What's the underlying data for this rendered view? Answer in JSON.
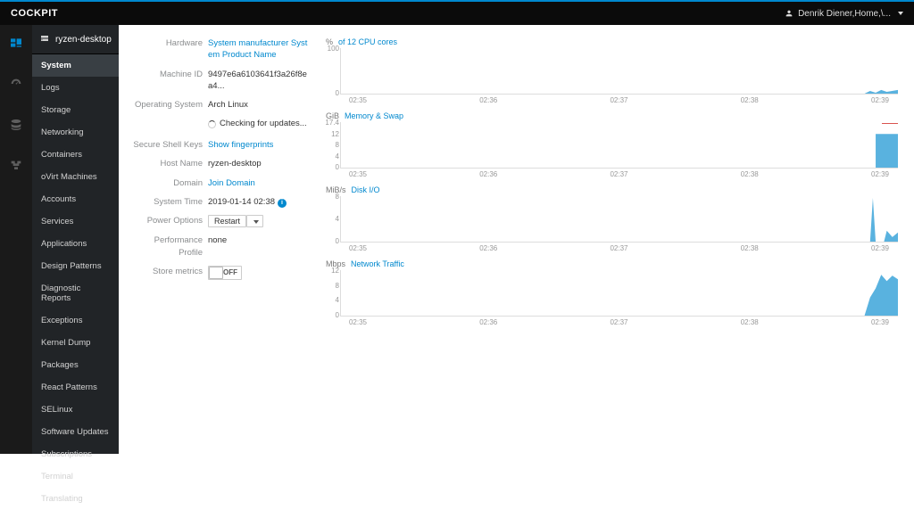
{
  "brand": "COCKPIT",
  "user_name": "Denrik Diener,Home,\\...",
  "host_name_header": "ryzen-desktop",
  "sidebar": {
    "items": [
      {
        "label": "System",
        "active": true
      },
      {
        "label": "Logs"
      },
      {
        "label": "Storage"
      },
      {
        "label": "Networking"
      },
      {
        "label": "Containers"
      },
      {
        "label": "oVirt Machines"
      },
      {
        "label": "Accounts"
      },
      {
        "label": "Services"
      },
      {
        "label": "Applications"
      },
      {
        "label": "Design Patterns"
      },
      {
        "label": "Diagnostic Reports"
      },
      {
        "label": "Exceptions"
      },
      {
        "label": "Kernel Dump"
      },
      {
        "label": "Packages"
      },
      {
        "label": "React Patterns"
      },
      {
        "label": "SELinux"
      },
      {
        "label": "Software Updates"
      },
      {
        "label": "Subscriptions"
      },
      {
        "label": "Terminal"
      },
      {
        "label": "Translating"
      }
    ]
  },
  "details": {
    "hardware_label": "Hardware",
    "hardware_value": "System manufacturer System Product Name",
    "machineid_label": "Machine ID",
    "machineid_value": "9497e6a6103641f3a26f8ea4...",
    "os_label": "Operating System",
    "os_value": "Arch Linux",
    "updates_value": "Checking for updates...",
    "ssh_label": "Secure Shell Keys",
    "ssh_value": "Show fingerprints",
    "hostname_label": "Host Name",
    "hostname_value": "ryzen-desktop",
    "domain_label": "Domain",
    "domain_value": "Join Domain",
    "systime_label": "System Time",
    "systime_value": "2019-01-14 02:38",
    "power_label": "Power Options",
    "power_value": "Restart",
    "perf_label": "Performance Profile",
    "perf_value": "none",
    "metrics_label": "Store metrics",
    "metrics_toggle": "OFF"
  },
  "x_ticks": [
    "02:35",
    "02:36",
    "02:37",
    "02:38",
    "02:39"
  ],
  "chart_data": [
    {
      "type": "area",
      "unit": "%",
      "title": "of 12 CPU cores",
      "ylim": [
        0,
        100
      ],
      "y_ticks": [
        "100",
        "0"
      ],
      "x": [
        "02:35",
        "02:36",
        "02:37",
        "02:38",
        "02:39"
      ],
      "series": [
        {
          "name": "cpu",
          "values_approx": "near 0 until ~02:38:45, small spike to ~8% near end"
        }
      ]
    },
    {
      "type": "area",
      "unit": "GiB",
      "title": "Memory & Swap",
      "ylim": [
        0,
        17.4
      ],
      "y_ticks": [
        "17.4",
        "12",
        "8",
        "4",
        "0"
      ],
      "x": [
        "02:35",
        "02:36",
        "02:37",
        "02:38",
        "02:39"
      ],
      "series": [
        {
          "name": "memory",
          "values_approx": "0 until ~02:38:50, step up to ~13 GiB at end"
        },
        {
          "name": "swap",
          "values_approx": "flat near max (~17 GiB) small red segment at end"
        }
      ]
    },
    {
      "type": "area",
      "unit": "MiB/s",
      "title": "Disk I/O",
      "ylim": [
        0,
        8
      ],
      "y_ticks": [
        "8",
        "4",
        "0"
      ],
      "x": [
        "02:35",
        "02:36",
        "02:37",
        "02:38",
        "02:39"
      ],
      "series": [
        {
          "name": "disk",
          "values_approx": "0 throughout, narrow spike to ~8 at ~02:38:55, small bumps near 02:39"
        }
      ]
    },
    {
      "type": "area",
      "unit": "Mbps",
      "title": "Network Traffic",
      "ylim": [
        0,
        12
      ],
      "y_ticks": [
        "12",
        "8",
        "4",
        "0"
      ],
      "x": [
        "02:35",
        "02:36",
        "02:37",
        "02:38",
        "02:39"
      ],
      "series": [
        {
          "name": "net",
          "values_approx": "0 throughout, rises near end peaking ~11 Mbps at 02:39"
        }
      ]
    }
  ]
}
